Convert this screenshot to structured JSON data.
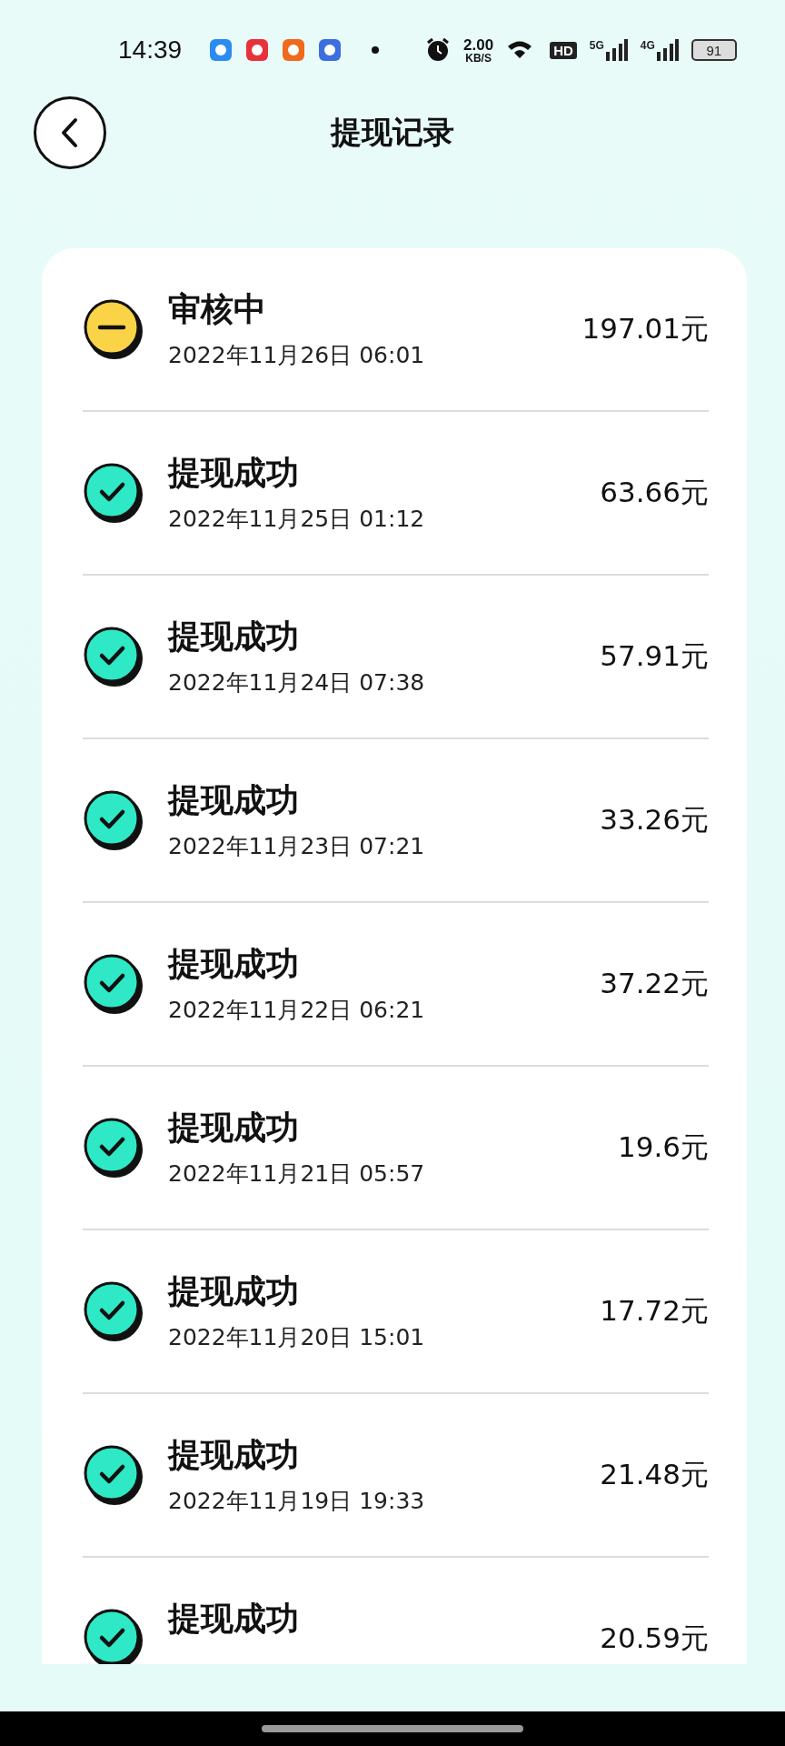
{
  "status_bar": {
    "time": "14:39",
    "net_speed": "2.00",
    "net_unit": "KB/S",
    "hd_label": "HD",
    "signal_1": "5G",
    "signal_2": "4G",
    "battery": "91"
  },
  "header": {
    "title": "提现记录"
  },
  "records": [
    {
      "kind": "pending",
      "status": "审核中",
      "date": "2022年11月26日 06:01",
      "amount": "197.01元"
    },
    {
      "kind": "success",
      "status": "提现成功",
      "date": "2022年11月25日 01:12",
      "amount": "63.66元"
    },
    {
      "kind": "success",
      "status": "提现成功",
      "date": "2022年11月24日 07:38",
      "amount": "57.91元"
    },
    {
      "kind": "success",
      "status": "提现成功",
      "date": "2022年11月23日 07:21",
      "amount": "33.26元"
    },
    {
      "kind": "success",
      "status": "提现成功",
      "date": "2022年11月22日 06:21",
      "amount": "37.22元"
    },
    {
      "kind": "success",
      "status": "提现成功",
      "date": "2022年11月21日 05:57",
      "amount": "19.6元"
    },
    {
      "kind": "success",
      "status": "提现成功",
      "date": "2022年11月20日 15:01",
      "amount": "17.72元"
    },
    {
      "kind": "success",
      "status": "提现成功",
      "date": "2022年11月19日 19:33",
      "amount": "21.48元"
    },
    {
      "kind": "success",
      "status": "提现成功",
      "amount": "20.59元"
    }
  ]
}
